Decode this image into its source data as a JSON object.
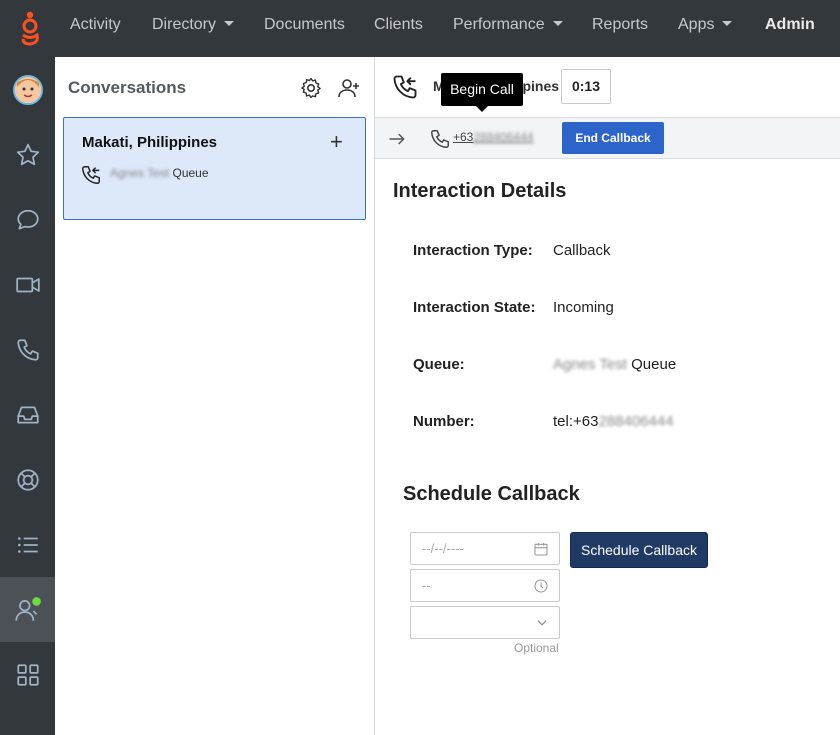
{
  "topnav": {
    "items": [
      {
        "label": "Activity"
      },
      {
        "label": "Directory"
      },
      {
        "label": "Documents"
      },
      {
        "label": "Clients"
      },
      {
        "label": "Performance"
      },
      {
        "label": "Reports"
      },
      {
        "label": "Apps"
      },
      {
        "label": "Admin"
      }
    ]
  },
  "sidebar": {
    "icons": [
      "avatar",
      "star-icon",
      "chat-icon",
      "video-icon",
      "phone-icon",
      "inbox-icon",
      "support-icon",
      "list-icon",
      "user-status-icon",
      "apps-grid-icon"
    ],
    "status_color": "#6ddc3a"
  },
  "conversations": {
    "title": "Conversations",
    "card": {
      "title": "Makati, Philippines",
      "queue_name": "Agnes Test",
      "queue_suffix": "Queue"
    }
  },
  "header": {
    "name": "Makati, Philippines",
    "timer": "0:13",
    "tooltip": "Begin Call"
  },
  "toolbar": {
    "phone_prefix": "+63",
    "phone_rest": "288406444",
    "end_label": "End Callback"
  },
  "details": {
    "title": "Interaction Details",
    "rows": [
      {
        "label": "Interaction Type:",
        "value": "Callback"
      },
      {
        "label": "Interaction State:",
        "value": "Incoming"
      },
      {
        "label": "Queue:",
        "value_blur": "Agnes Test",
        "value": "Queue"
      },
      {
        "label": "Number:",
        "value": "tel:+63",
        "value_blur": "288406444"
      }
    ]
  },
  "schedule": {
    "title": "Schedule Callback",
    "date_placeholder": "--/--/----",
    "time_placeholder": "--",
    "optional_label": "Optional",
    "button_label": "Schedule Callback"
  },
  "colors": {
    "nav_bg": "#33383d",
    "brand": "#ff4f1f",
    "card_bg": "#dde8f9",
    "primary_button": "#2d64c9",
    "schedule_button": "#203a66"
  }
}
